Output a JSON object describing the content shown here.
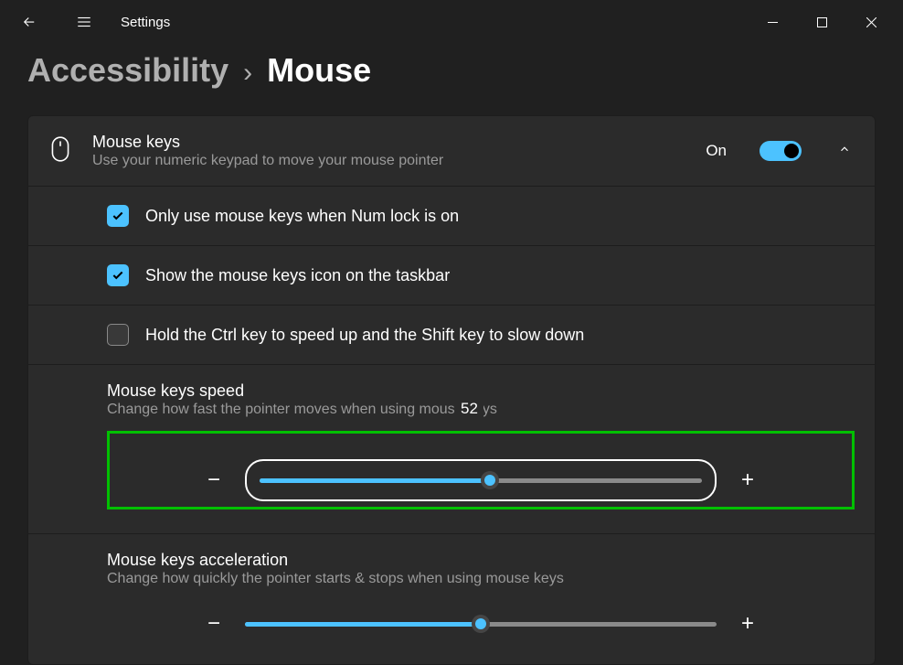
{
  "app": {
    "title": "Settings"
  },
  "breadcrumb": {
    "parent": "Accessibility",
    "sep": "›",
    "current": "Mouse"
  },
  "mouseKeys": {
    "title": "Mouse keys",
    "desc": "Use your numeric keypad to move your mouse pointer",
    "toggleLabel": "On",
    "toggleOn": true
  },
  "options": {
    "numlock": {
      "label": "Only use mouse keys when Num lock is on",
      "checked": true
    },
    "taskbar": {
      "label": "Show the mouse keys icon on the taskbar",
      "checked": true
    },
    "ctrlshift": {
      "label": "Hold the Ctrl key to speed up and the Shift key to slow down",
      "checked": false
    }
  },
  "speed": {
    "title": "Mouse keys speed",
    "desc": "Change how fast the pointer moves when using mouse keys",
    "value": 52,
    "percent": 52,
    "tooltipText": "52"
  },
  "accel": {
    "title": "Mouse keys acceleration",
    "desc": "Change how quickly the pointer starts & stops when using mouse keys",
    "value": 50,
    "percent": 50
  }
}
